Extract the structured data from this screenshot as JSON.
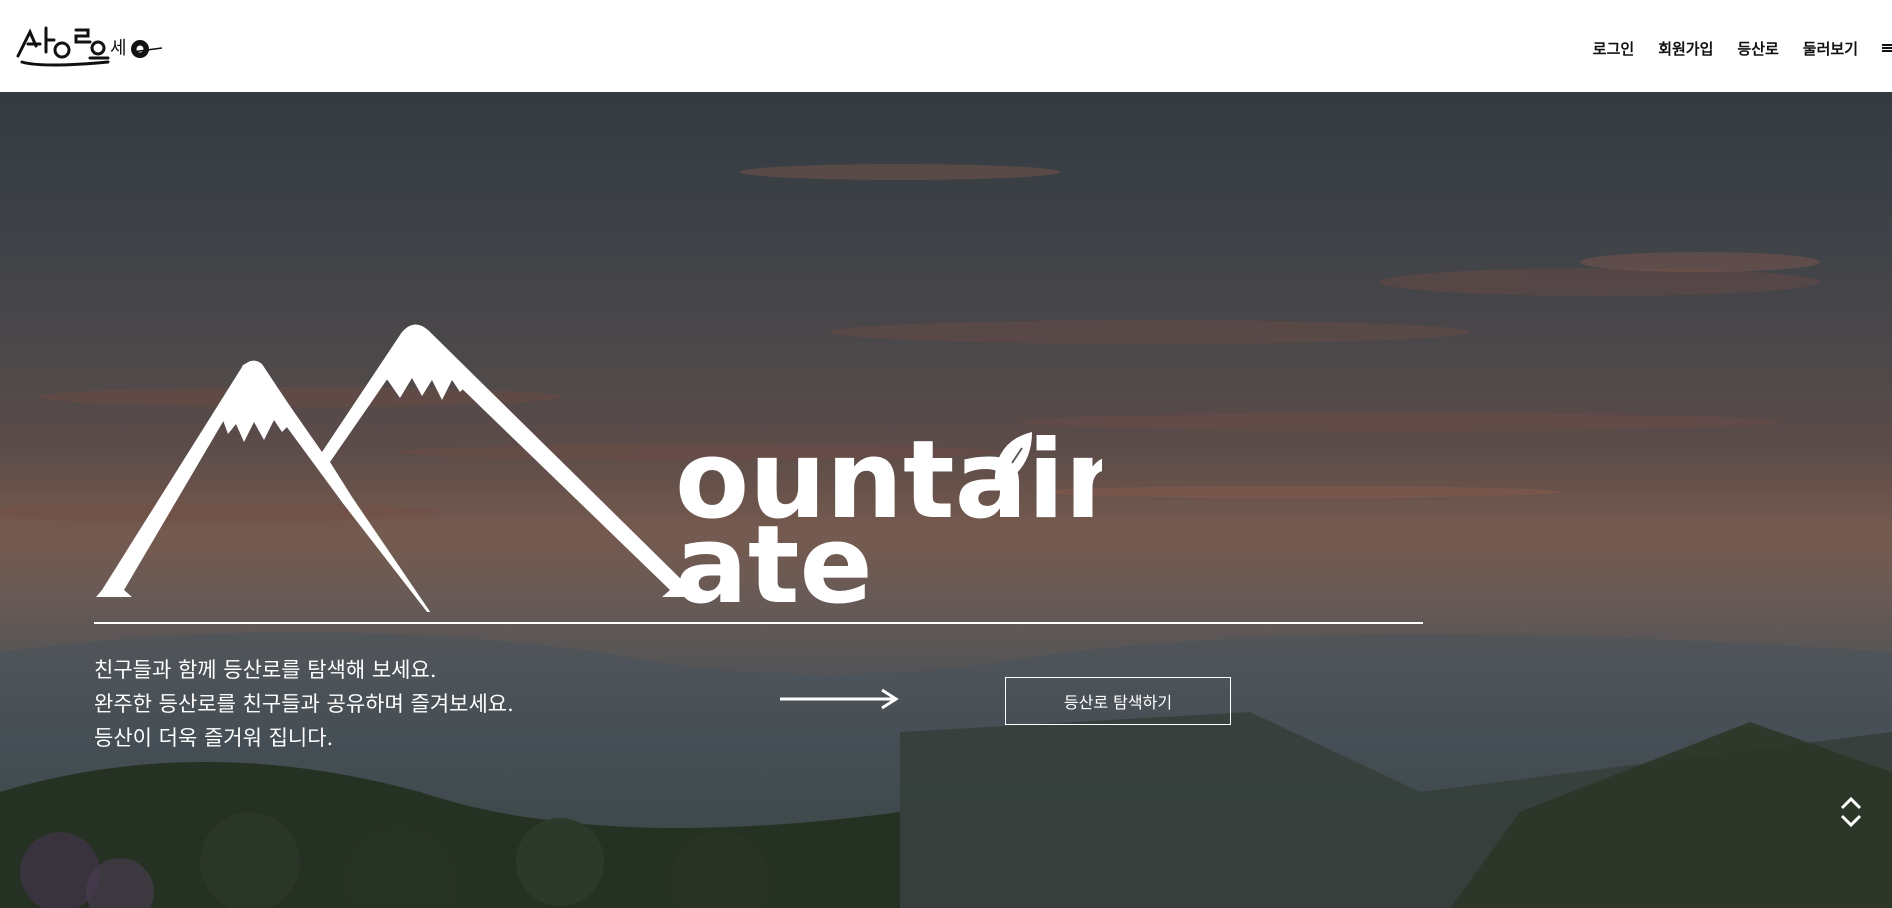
{
  "header": {
    "logo_text": "산이오세O",
    "nav": [
      {
        "label": "로그인"
      },
      {
        "label": "회원가입"
      },
      {
        "label": "등산로"
      },
      {
        "label": "둘러보기"
      }
    ],
    "menu_icon": "hamburger-icon"
  },
  "hero": {
    "brand_logo_text": "Mountain Mate",
    "tagline": [
      "친구들과 함께 등산로를 탐색해 보세요.",
      "완주한 등산로를 친구들과 공유하며 즐겨보세요.",
      "등산이 더욱 즐거워 집니다."
    ],
    "arrow_icon": "arrow-right-icon",
    "cta_label": "등산로 탐색하기",
    "scroll_icon": "chevron-up-down-icon"
  },
  "colors": {
    "header_bg": "#ffffff",
    "header_text": "#111111",
    "hero_text": "#ffffff"
  }
}
